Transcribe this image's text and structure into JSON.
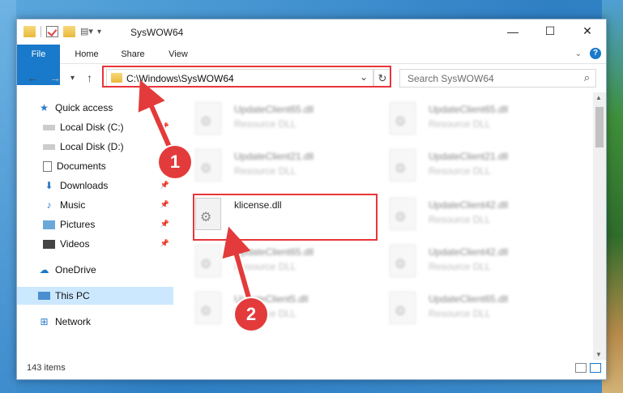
{
  "window": {
    "title": "SysWOW64",
    "controls": {
      "minimize": "—",
      "maximize": "☐",
      "close": "✕"
    }
  },
  "ribbon": {
    "tabs": [
      "File",
      "Home",
      "Share",
      "View"
    ]
  },
  "address": {
    "path": "C:\\Windows\\SysWOW64",
    "search_placeholder": "Search SysWOW64"
  },
  "sidebar": {
    "items": [
      {
        "label": "Quick access",
        "icon": "star-icon"
      },
      {
        "label": "Local Disk (C:)",
        "icon": "drive-icon"
      },
      {
        "label": "Local Disk (D:)",
        "icon": "drive-icon"
      },
      {
        "label": "Documents",
        "icon": "document-icon"
      },
      {
        "label": "Downloads",
        "icon": "download-icon"
      },
      {
        "label": "Music",
        "icon": "music-icon"
      },
      {
        "label": "Pictures",
        "icon": "pictures-icon"
      },
      {
        "label": "Videos",
        "icon": "video-icon"
      },
      {
        "label": "OneDrive",
        "icon": "cloud-icon"
      },
      {
        "label": "This PC",
        "icon": "computer-icon"
      },
      {
        "label": "Network",
        "icon": "network-icon"
      }
    ]
  },
  "files": [
    {
      "name": "UpdateClient65.dll",
      "type": "Resource DLL"
    },
    {
      "name": "UpdateClient65.dll",
      "type": "Resource DLL"
    },
    {
      "name": "UpdateClient21.dll",
      "type": "Resource DLL"
    },
    {
      "name": "UpdateClient21.dll",
      "type": "Resource DLL"
    },
    {
      "name": "klicense.dll",
      "type": ""
    },
    {
      "name": "UpdateClient42.dll",
      "type": "Resource DLL"
    },
    {
      "name": "UpdateClient65.dll",
      "type": "Resource DLL"
    },
    {
      "name": "UpdateClient42.dll",
      "type": "Resource DLL"
    },
    {
      "name": "UpdateClient5.dll",
      "type": "Resource DLL"
    },
    {
      "name": "UpdateClient65.dll",
      "type": "Resource DLL"
    }
  ],
  "status": {
    "count": "143 items"
  },
  "annotations": {
    "step1": "1",
    "step2": "2"
  },
  "colors": {
    "accent": "#1979ca",
    "highlight": "#e8353a",
    "selected": "#cce8ff"
  }
}
